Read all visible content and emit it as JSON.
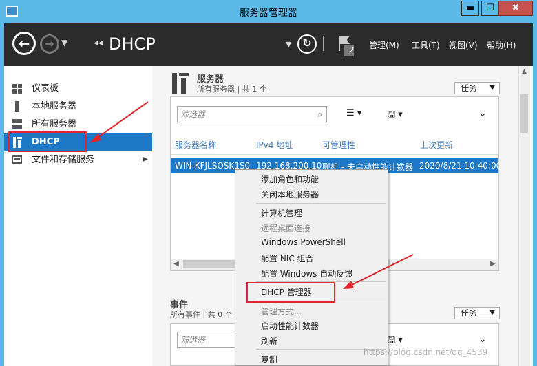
{
  "window": {
    "title": "服务器管理器",
    "minimize": "▬",
    "maximize": "☐",
    "close": "✖"
  },
  "navbar": {
    "breadcrumb": "DHCP",
    "menus": [
      {
        "label": "管理(M)"
      },
      {
        "label": "工具(T)"
      },
      {
        "label": "视图(V)"
      },
      {
        "label": "帮助(H)"
      }
    ],
    "notification_count": "2"
  },
  "sidebar": {
    "items": [
      {
        "label": "仪表板",
        "icon": "dashboard-icon"
      },
      {
        "label": "本地服务器",
        "icon": "server-icon"
      },
      {
        "label": "所有服务器",
        "icon": "servers-icon"
      },
      {
        "label": "DHCP",
        "icon": "dhcp-icon",
        "selected": true
      },
      {
        "label": "文件和存储服务",
        "icon": "storage-icon",
        "has_submenu": true
      }
    ]
  },
  "servers_section": {
    "title": "服务器",
    "subtitle": "所有服务器 | 共 1 个",
    "tasks_label": "任务",
    "filter_placeholder": "筛选器",
    "columns": [
      "服务器名称",
      "IPv4 地址",
      "可管理性",
      "上次更新"
    ],
    "rows": [
      {
        "name": "WIN-KFJLSOSK1S0",
        "ipv4": "192.168.200.10",
        "manageability": "联机 - 未启动性能计数器",
        "last_update": "2020/8/21 10:40:00"
      }
    ]
  },
  "events_section": {
    "title": "事件",
    "subtitle": "所有事件 | 共 0 个",
    "tasks_label": "任务",
    "filter_placeholder": "筛选器"
  },
  "context_menu": {
    "groups": [
      [
        {
          "label": "添加角色和功能"
        },
        {
          "label": "关闭本地服务器"
        }
      ],
      [
        {
          "label": "计算机管理"
        },
        {
          "label": "远程桌面连接",
          "disabled": true
        },
        {
          "label": "Windows PowerShell"
        },
        {
          "label": "配置 NIC 组合"
        },
        {
          "label": "配置 Windows 自动反馈"
        }
      ],
      [
        {
          "label": "DHCP 管理器"
        }
      ],
      [
        {
          "label": "管理方式...",
          "disabled": true
        },
        {
          "label": "启动性能计数器"
        },
        {
          "label": "刷新"
        }
      ],
      [
        {
          "label": "复制"
        }
      ]
    ]
  },
  "watermark": "https://blog.csdn.net/qq_4539",
  "colors": {
    "titlebar": "#5cb8e6",
    "navbar": "#2b2b2b",
    "selection": "#1e78c8",
    "annotation": "#e0262a"
  }
}
